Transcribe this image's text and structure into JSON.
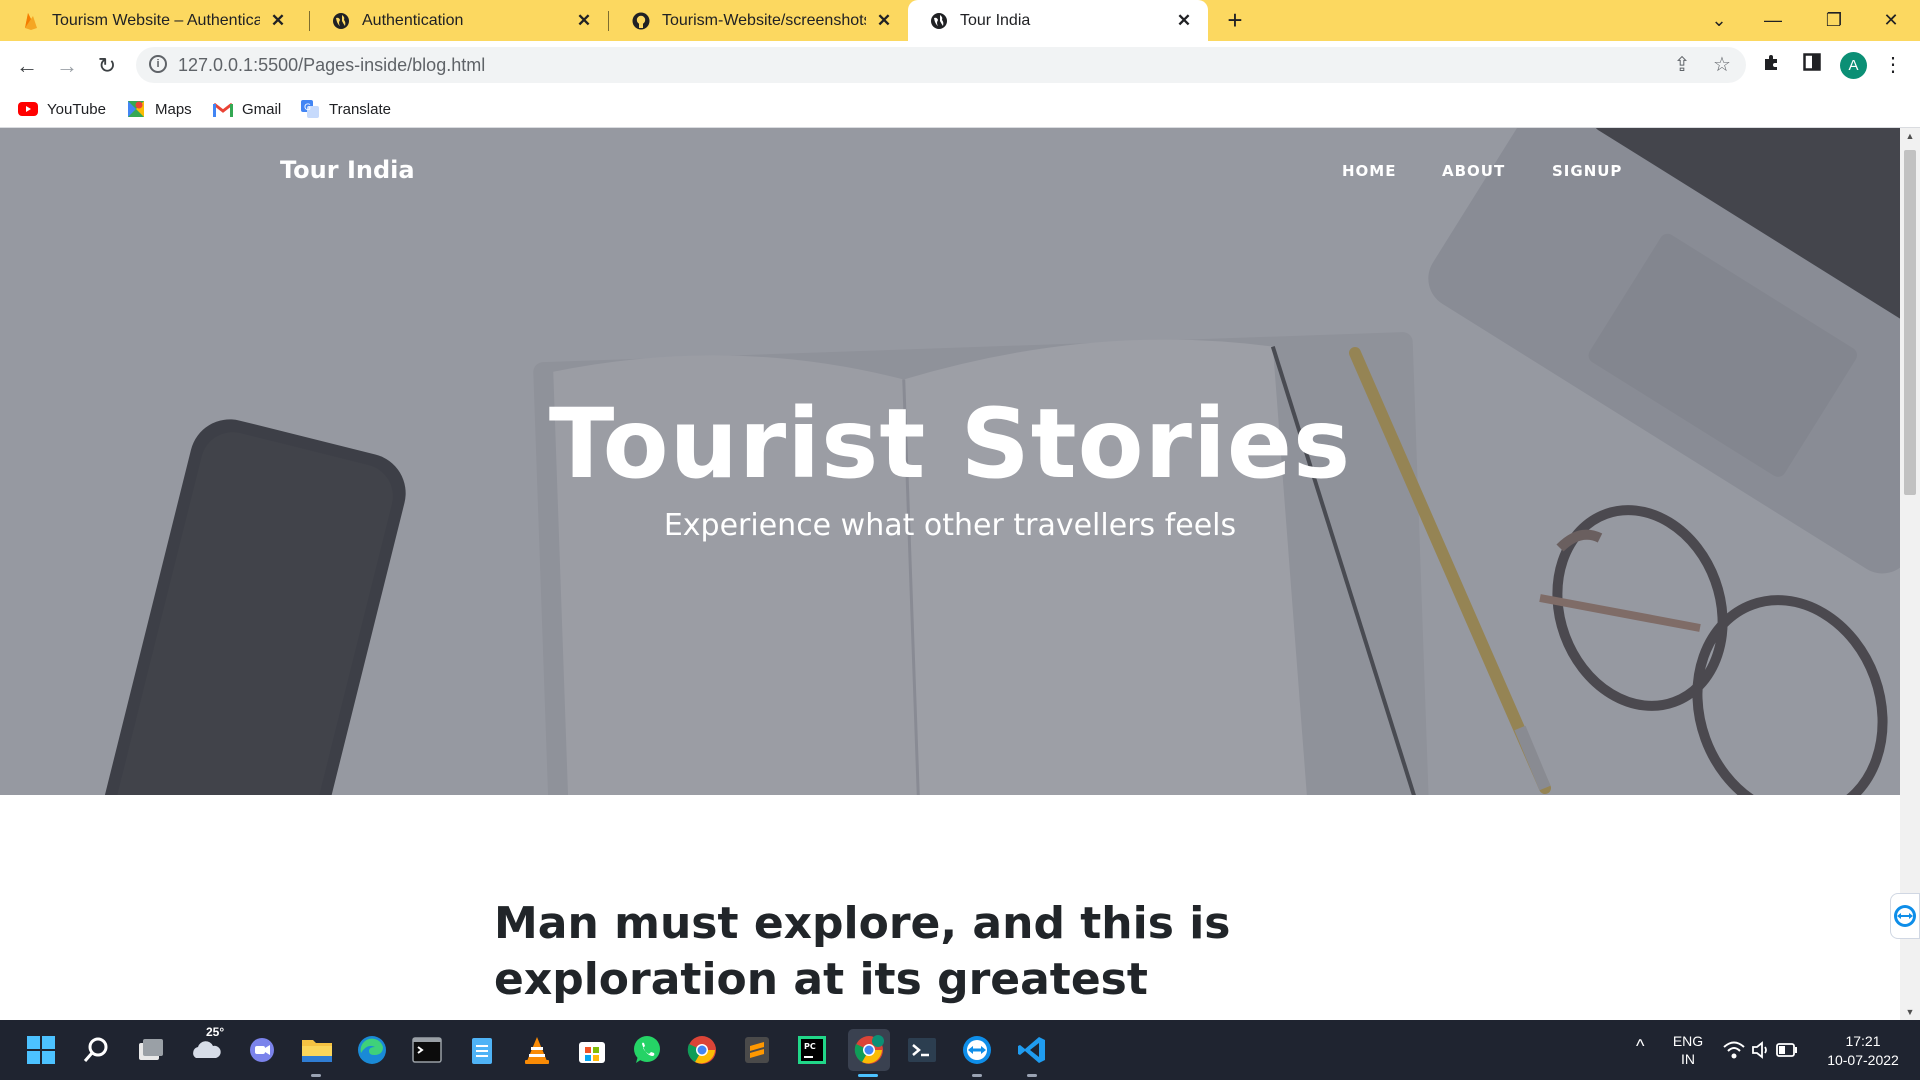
{
  "browser": {
    "tabs": [
      {
        "label": "Tourism Website – Authenticatio",
        "icon": "firebase-icon",
        "active": false
      },
      {
        "label": "Authentication",
        "icon": "globe-icon",
        "active": false
      },
      {
        "label": "Tourism-Website/screenshots at",
        "icon": "github-icon",
        "active": false
      },
      {
        "label": "Tour India",
        "icon": "globe-icon",
        "active": true
      }
    ],
    "new_tab_symbol": "+",
    "url": "127.0.0.1:5500/Pages-inside/blog.html",
    "profile_initial": "A",
    "bookmarks": [
      {
        "label": "YouTube",
        "icon": "youtube-icon"
      },
      {
        "label": "Maps",
        "icon": "maps-icon"
      },
      {
        "label": "Gmail",
        "icon": "gmail-icon"
      },
      {
        "label": "Translate",
        "icon": "translate-icon"
      }
    ]
  },
  "site": {
    "brand": "Tour India",
    "nav": [
      "HOME",
      "ABOUT",
      "SIGNUP"
    ],
    "hero_title": "Tourist Stories",
    "hero_subtitle": "Experience what other travellers feels",
    "post_title_line1": "Man must explore, and this is",
    "post_title_line2": "exploration at its greatest"
  },
  "taskbar": {
    "weather_temp": "25°",
    "language": "ENG",
    "region": "IN",
    "time": "17:21",
    "date": "10-07-2022",
    "apps": [
      "start-icon",
      "search-icon",
      "task-view-icon",
      "weather-icon",
      "teams-chat-icon",
      "file-explorer-icon",
      "edge-icon",
      "terminal-icon",
      "notepad-icon",
      "vlc-icon",
      "store-icon",
      "whatsapp-icon",
      "chrome-icon",
      "sublime-icon",
      "pycharm-icon",
      "chrome-profile-icon",
      "powershell-icon",
      "teamviewer-icon",
      "vscode-icon"
    ]
  },
  "colors": {
    "tabstrip": "#fcd860",
    "taskbar": "#1f2430",
    "avatar": "#0b8f75",
    "hero_overlay": "#5f636e"
  }
}
